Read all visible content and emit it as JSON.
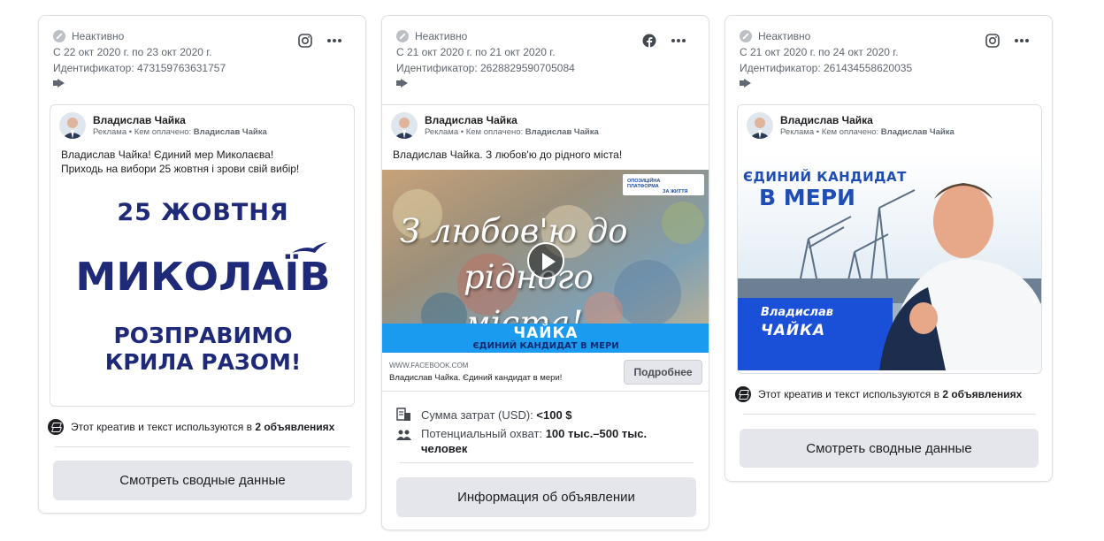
{
  "cards": [
    {
      "status": "Неактивно",
      "dates": "С 22 окт 2020 г. по 23 окт 2020 г.",
      "id_line": "Идентификатор: 473159763631757",
      "platform": "instagram-icon",
      "page_name": "Владислав Чайка",
      "sponsored_prefix": "Реклама • Кем оплачено:",
      "sponsored_by": "Владислав Чайка",
      "ad_text_lines": [
        "Владислав Чайка! Єдиний мер Миколаєва!",
        "Приходь на вибори 25 жовтня і зрови свій вибір!"
      ],
      "creative": {
        "date": "25 ЖОВТНЯ",
        "city": "МИКОЛАЇВ",
        "slogan_1": "РОЗПРАВИМО",
        "slogan_2": "КРИЛА РАЗОМ!"
      },
      "usage_prefix": "Этот креатив и текст используются в",
      "usage_count": "2 объявлениях",
      "button": "Смотреть сводные данные"
    },
    {
      "status": "Неактивно",
      "dates": "С 21 окт 2020 г. по 21 окт 2020 г.",
      "id_line": "Идентификатор: 2628829590705084",
      "platform": "facebook-icon",
      "page_name": "Владислав Чайка",
      "sponsored_prefix": "Реклама • Кем оплачено:",
      "sponsored_by": "Владислав Чайка",
      "ad_text_lines": [
        "Владислав Чайка. З любов'ю до рідного міста!"
      ],
      "video": {
        "title_1": "З любов'ю до",
        "title_2": "рідного міста!",
        "band_logo": "ЧАЙКА",
        "band_sub": "ЄДИНИЙ КАНДИДАТ В МЕРИ",
        "party_1": "ОПОЗИЦІЙНА ПЛАТФОРМА",
        "party_2": "ЗА ЖИТТЯ"
      },
      "link_domain": "WWW.FACEBOOK.COM",
      "link_title": "Владислав Чайка. Єдиний кандидат в мери!",
      "link_button": "Подробнее",
      "spend_label": "Сумма затрат (USD):",
      "spend_value": "<100 $",
      "reach_label": "Потенциальный охват:",
      "reach_value": "100 тыс.–500 тыс.",
      "reach_value_2": "человек",
      "button": "Информация об объявлении"
    },
    {
      "status": "Неактивно",
      "dates": "С 21 окт 2020 г. по 24 окт 2020 г.",
      "id_line": "Идентификатор: 261434558620035",
      "platform": "instagram-icon",
      "page_name": "Владислав Чайка",
      "sponsored_prefix": "Реклама • Кем оплачено:",
      "sponsored_by": "Владислав Чайка",
      "creative": {
        "headline_1": "ЄДИНИЙ КАНДИДАТ",
        "headline_2": "В МЕРИ",
        "name_1": "Владислав",
        "name_2": "ЧАЙКА"
      },
      "usage_prefix": "Этот креатив и текст используются в",
      "usage_count": "2 объявлениях",
      "button": "Смотреть сводные данные"
    }
  ],
  "colors": {
    "facebook_blue": "#1877f2",
    "brand_navy": "#1e2a78",
    "band_blue": "#1a9bf0"
  }
}
